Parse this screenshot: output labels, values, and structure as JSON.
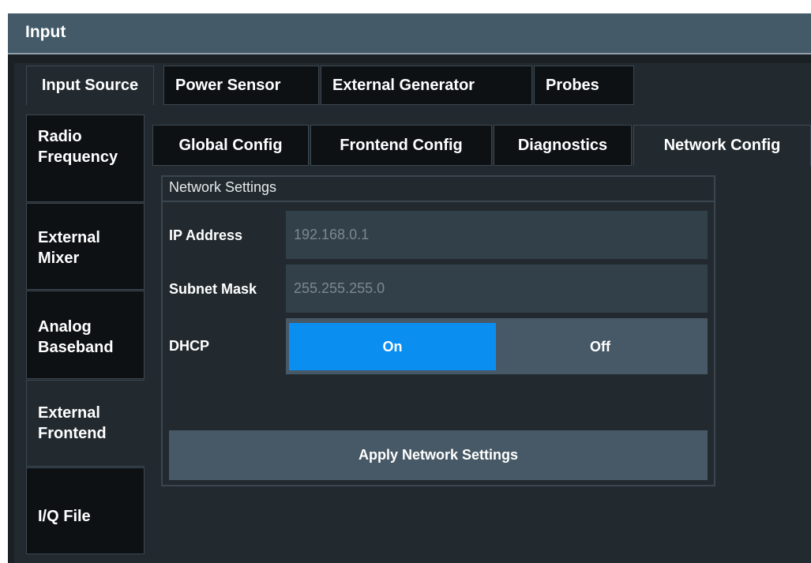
{
  "window": {
    "title": "Input"
  },
  "tabs": [
    {
      "label": "Input Source",
      "active": true
    },
    {
      "label": "Power Sensor",
      "active": false
    },
    {
      "label": "External Generator",
      "active": false
    },
    {
      "label": "Probes",
      "active": false
    }
  ],
  "side_tabs": [
    {
      "label": "Radio Frequency",
      "active": false
    },
    {
      "label": "External Mixer",
      "active": false
    },
    {
      "label": "Analog Baseband",
      "active": false
    },
    {
      "label": "External Frontend",
      "active": true
    },
    {
      "label": "I/Q File",
      "active": false
    }
  ],
  "sub_tabs": [
    {
      "label": "Global Config",
      "active": false
    },
    {
      "label": "Frontend Config",
      "active": false
    },
    {
      "label": "Diagnostics",
      "active": false
    },
    {
      "label": "Network Config",
      "active": true
    }
  ],
  "network": {
    "group_title": "Network Settings",
    "ip_label": "IP Address",
    "ip_value": "192.168.0.1",
    "subnet_label": "Subnet Mask",
    "subnet_value": "255.255.255.0",
    "dhcp_label": "DHCP",
    "dhcp_on": "On",
    "dhcp_off": "Off",
    "dhcp_selected": "On",
    "apply_label": "Apply Network Settings"
  },
  "colors": {
    "titlebar": "#445a68",
    "accent": "#0a8ef0",
    "background": "#222a30"
  }
}
